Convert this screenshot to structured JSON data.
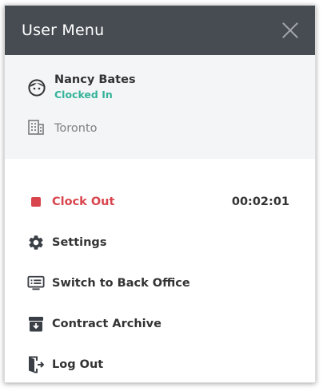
{
  "header": {
    "title": "User Menu",
    "close_icon": "close-icon"
  },
  "user": {
    "name": "Nancy Bates",
    "status": "Clocked In",
    "status_color": "#35b39a",
    "location": "Toronto",
    "avatar_icon": "face-icon",
    "location_icon": "building-icon"
  },
  "menu": {
    "items": [
      {
        "label": "Clock Out",
        "icon": "stop-icon",
        "color": "#d8454d",
        "timer": "00:02:01"
      },
      {
        "label": "Settings",
        "icon": "gear-icon"
      },
      {
        "label": "Switch to Back Office",
        "icon": "desktop-list-icon"
      },
      {
        "label": "Contract Archive",
        "icon": "archive-box-icon"
      },
      {
        "label": "Log Out",
        "icon": "log-out-icon"
      }
    ]
  }
}
